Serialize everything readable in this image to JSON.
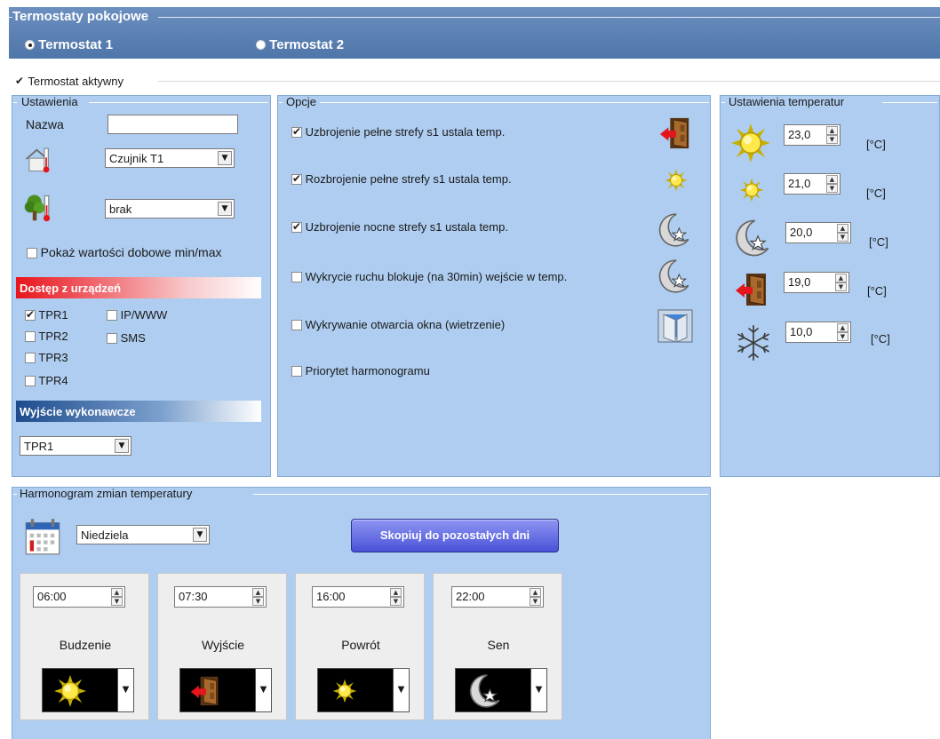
{
  "header": {
    "title": "Termostaty pokojowe",
    "radios": [
      {
        "label": "Termostat 1",
        "selected": true
      },
      {
        "label": "Termostat 2",
        "selected": false
      }
    ]
  },
  "active": {
    "label": "Termostat aktywny",
    "checked": true
  },
  "ustawienia": {
    "legend": "Ustawienia",
    "name_label": "Nazwa",
    "name_value": "",
    "sensor1": "Czujnik T1",
    "sensor2": "brak",
    "show_minmax": {
      "label": "Pokaż wartości dobowe min/max",
      "checked": false
    },
    "access_header": "Dostęp z urządzeń",
    "access": [
      {
        "label": "TPR1",
        "checked": true
      },
      {
        "label": "TPR2",
        "checked": false
      },
      {
        "label": "TPR3",
        "checked": false
      },
      {
        "label": "TPR4",
        "checked": false
      },
      {
        "label": "IP/WWW",
        "checked": false
      },
      {
        "label": "SMS",
        "checked": false
      }
    ],
    "output_header": "Wyjście wykonawcze",
    "output_value": "TPR1"
  },
  "opcje": {
    "legend": "Opcje",
    "items": [
      {
        "label": "Uzbrojenie pełne strefy s1 ustala temp.",
        "checked": true,
        "icon": "door-exit-icon"
      },
      {
        "label": "Rozbrojenie pełne strefy s1 ustala temp.",
        "checked": true,
        "icon": "sun-icon"
      },
      {
        "label": "Uzbrojenie nocne strefy s1 ustala temp.",
        "checked": true,
        "icon": "moon-star-icon"
      },
      {
        "label": "Wykrycie ruchu blokuje (na 30min) wejście w temp.",
        "checked": false,
        "icon": "moon-star-icon"
      },
      {
        "label": "Wykrywanie otwarcia okna (wietrzenie)",
        "checked": false,
        "icon": "window-icon"
      },
      {
        "label": "Priorytet harmonogramu",
        "checked": false,
        "icon": ""
      }
    ]
  },
  "temps": {
    "legend": "Ustawienia temperatur",
    "unit": "[°C]",
    "rows": [
      {
        "icon": "sun-large-icon",
        "value": "23,0"
      },
      {
        "icon": "sun-small-icon",
        "value": "21,0"
      },
      {
        "icon": "moon-star-icon",
        "value": "20,0"
      },
      {
        "icon": "door-exit-icon",
        "value": "19,0"
      },
      {
        "icon": "snowflake-icon",
        "value": "10,0"
      }
    ]
  },
  "schedule": {
    "legend": "Harmonogram zmian temperatury",
    "day": "Niedziela",
    "copy_button": "Skopiuj do pozostałych dni",
    "cards": [
      {
        "time": "06:00",
        "label": "Budzenie",
        "icon": "sun-large-icon"
      },
      {
        "time": "07:30",
        "label": "Wyjście",
        "icon": "door-exit-icon"
      },
      {
        "time": "16:00",
        "label": "Powrót",
        "icon": "sun-small-icon"
      },
      {
        "time": "22:00",
        "label": "Sen",
        "icon": "moon-star-icon"
      }
    ]
  },
  "colors": {
    "header": "#5a80b3",
    "panel": "#aecdf0",
    "access_red": "#e8141c",
    "output_blue": "#1d4b8c",
    "button": "#5a62e0"
  }
}
